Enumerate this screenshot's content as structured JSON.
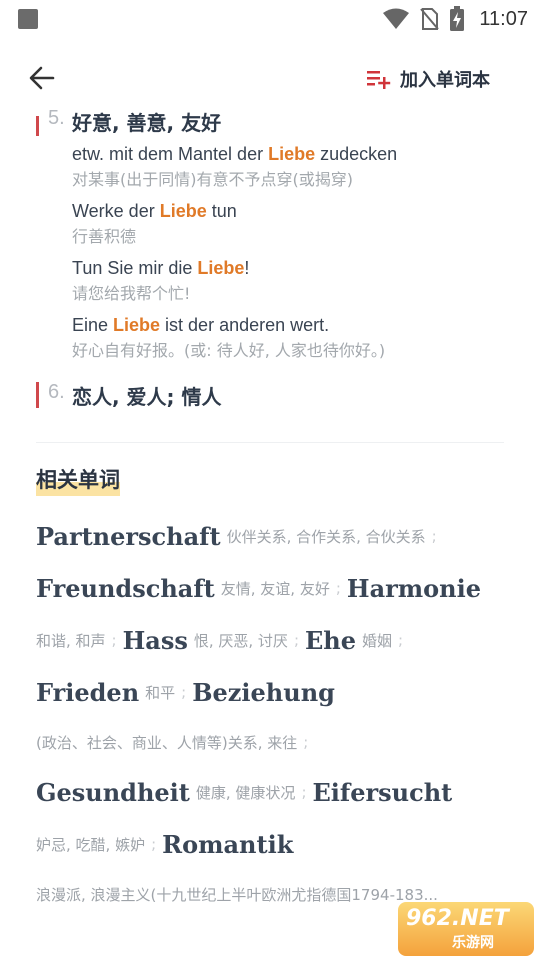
{
  "status_bar": {
    "time": "11:07"
  },
  "app_bar": {
    "add_vocab_label": "加入单词本"
  },
  "senses": [
    {
      "number": "5.",
      "definition": "好意, 善意, 友好"
    },
    {
      "number": "6.",
      "definition": "恋人, 爱人; 情人"
    }
  ],
  "examples": [
    {
      "de_before": "etw. mit dem Mantel der ",
      "de_hl": "Liebe",
      "de_after": " zudecken",
      "zh": "对某事(出于同情)有意不予点穿(或揭穿)"
    },
    {
      "de_before": "Werke der ",
      "de_hl": "Liebe",
      "de_after": " tun",
      "zh": "行善积德"
    },
    {
      "de_before": "Tun Sie mir die ",
      "de_hl": "Liebe",
      "de_after": "!",
      "zh": "请您给我帮个忙!"
    },
    {
      "de_before": "Eine ",
      "de_hl": "Liebe",
      "de_after": " ist der anderen wert.",
      "zh": "好心自有好报。(或: 待人好, 人家也待你好。)"
    }
  ],
  "related": {
    "title": "相关单词",
    "words": [
      {
        "word": "Partnerschaft",
        "gloss": "伙伴关系, 合作关系, 合伙关系"
      },
      {
        "word": "Freundschaft",
        "gloss": "友情, 友谊, 友好"
      },
      {
        "word": "Harmonie",
        "gloss": "和谐, 和声"
      },
      {
        "word": "Hass",
        "gloss": "恨, 厌恶, 讨厌"
      },
      {
        "word": "Ehe",
        "gloss": "婚姻"
      },
      {
        "word": "Frieden",
        "gloss": "和平"
      },
      {
        "word": "Beziehung",
        "gloss": "(政治、社会、商业、人情等)关系, 来往"
      },
      {
        "word": "Gesundheit",
        "gloss": "健康, 健康状况"
      },
      {
        "word": "Eifersucht",
        "gloss": "妒忌, 吃醋, 嫉妒"
      },
      {
        "word": "Romantik",
        "gloss": "浪漫派, 浪漫主义(十九世纪上半叶欧洲尤指德国1794-183..."
      }
    ],
    "separator": ";"
  },
  "watermark": {
    "text": "962.NET",
    "sub": "乐游网"
  },
  "colors": {
    "accent": "#e07a28",
    "marker": "#d0484c",
    "highlight": "#fbe3a3"
  }
}
